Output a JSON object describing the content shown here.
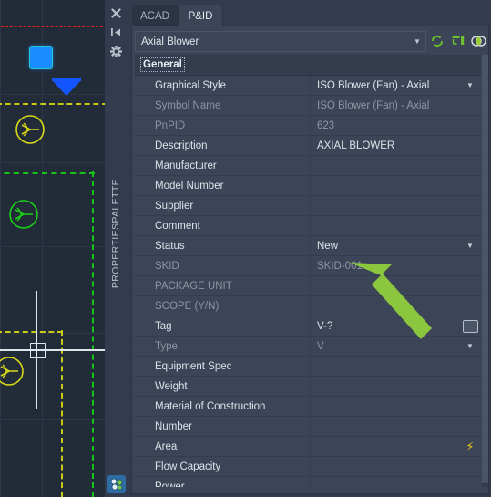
{
  "app": {
    "palette_title": "PROPERTIESPALETTE",
    "rail_icons": [
      "close-icon",
      "auto-hide-icon",
      "properties-settings-icon"
    ],
    "bottom_icon": "properties-palette-icon"
  },
  "tabs": [
    {
      "label": "ACAD",
      "active": false
    },
    {
      "label": "P&ID",
      "active": true
    }
  ],
  "object_selector": {
    "value": "Axial Blower",
    "arrow": "chevron-down-icon"
  },
  "toolbar": [
    {
      "name": "refresh-icon",
      "label": "Refresh"
    },
    {
      "name": "export-data-icon",
      "label": "Export Data"
    },
    {
      "name": "relationships-icon",
      "label": "Relationships"
    }
  ],
  "group": {
    "label": "General"
  },
  "properties": [
    {
      "label": "Graphical Style",
      "value": "ISO Blower (Fan) - Axial",
      "dim": false,
      "action": "chevron-down-icon"
    },
    {
      "label": "Symbol Name",
      "value": "ISO Blower (Fan) - Axial",
      "dim": true,
      "action": ""
    },
    {
      "label": "PnPID",
      "value": "623",
      "dim": true,
      "action": ""
    },
    {
      "label": "Description",
      "value": "AXIAL BLOWER",
      "dim": false,
      "action": ""
    },
    {
      "label": "Manufacturer",
      "value": "",
      "dim": false,
      "action": ""
    },
    {
      "label": "Model Number",
      "value": "",
      "dim": false,
      "action": ""
    },
    {
      "label": "Supplier",
      "value": "",
      "dim": false,
      "action": ""
    },
    {
      "label": "Comment",
      "value": "",
      "dim": false,
      "action": ""
    },
    {
      "label": "Status",
      "value": "New",
      "dim": false,
      "action": "chevron-down-icon"
    },
    {
      "label": "SKID",
      "value": "SKID-001",
      "dim": true,
      "action": ""
    },
    {
      "label": "PACKAGE UNIT",
      "value": "",
      "dim": true,
      "action": ""
    },
    {
      "label": "SCOPE (Y/N)",
      "value": "",
      "dim": true,
      "action": ""
    },
    {
      "label": "Tag",
      "value": "V-?",
      "dim": false,
      "action": "ellipsis-button-icon"
    },
    {
      "label": "Type",
      "value": "V",
      "dim": true,
      "action": "chevron-down-icon"
    },
    {
      "label": "Equipment Spec",
      "value": "",
      "dim": false,
      "action": ""
    },
    {
      "label": "Weight",
      "value": "",
      "dim": false,
      "action": ""
    },
    {
      "label": "Material of Construction",
      "value": "",
      "dim": false,
      "action": ""
    },
    {
      "label": "Number",
      "value": "",
      "dim": false,
      "action": ""
    },
    {
      "label": "Area",
      "value": "",
      "dim": false,
      "action": "lightning-bolt-icon"
    },
    {
      "label": "Flow Capacity",
      "value": "",
      "dim": false,
      "action": ""
    },
    {
      "label": "Power",
      "value": "",
      "dim": false,
      "action": ""
    }
  ],
  "annotation": {
    "name": "pointer-arrow",
    "color": "#8cc63f",
    "points_at": "SKID-001"
  },
  "colors": {
    "canvas_bg": "#222b38",
    "panel_bg": "#3b4557",
    "rail_bg": "#323c4e",
    "text": "#dde2ea",
    "text_dim": "#8d95a4",
    "accent_green": "#6fbf2f",
    "bolt_yellow": "#f5c518"
  }
}
